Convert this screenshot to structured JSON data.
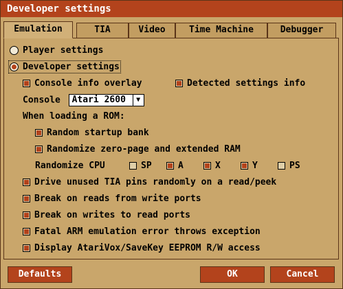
{
  "window": {
    "title": "Developer settings"
  },
  "tabs": [
    {
      "label": "Emulation"
    },
    {
      "label": "TIA"
    },
    {
      "label": "Video"
    },
    {
      "label": "Time Machine"
    },
    {
      "label": "Debugger"
    }
  ],
  "emulation": {
    "player_settings": "Player settings",
    "developer_settings": "Developer settings",
    "console_info_overlay": "Console info overlay",
    "detected_settings_info": "Detected settings info",
    "console_label": "Console",
    "console_value": "Atari 2600",
    "loading_rom_label": "When loading a ROM:",
    "random_startup_bank": "Random startup bank",
    "randomize_zero_page": "Randomize zero-page and extended RAM",
    "randomize_cpu_label": "Randomize CPU",
    "cpu_sp": "SP",
    "cpu_a": "A",
    "cpu_x": "X",
    "cpu_y": "Y",
    "cpu_ps": "PS",
    "drive_unused_tia": "Drive unused TIA pins randomly on a read/peek",
    "break_reads": "Break on reads from write ports",
    "break_writes": "Break on writes to read ports",
    "fatal_arm": "Fatal ARM emulation error throws exception",
    "display_atarivox": "Display AtariVox/SaveKey EEPROM R/W access"
  },
  "buttons": {
    "defaults": "Defaults",
    "ok": "OK",
    "cancel": "Cancel"
  },
  "colors": {
    "accent": "#b3431c",
    "background": "#c9a66b",
    "border": "#5a3418"
  }
}
